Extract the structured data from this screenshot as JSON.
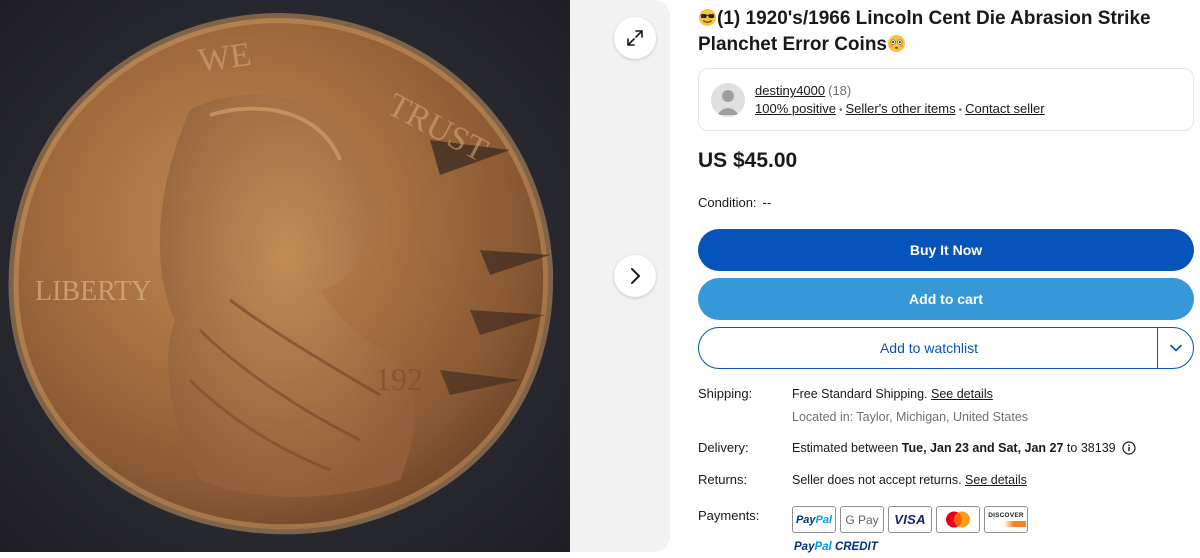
{
  "listing": {
    "title": "(1) 1920's/1966 Lincoln Cent Die Abrasion Strike Planchet Error Coins",
    "title_emoji_start": "smiling-face-with-sunglasses",
    "title_emoji_end": "flushed-face"
  },
  "photo": {
    "coin_text_liberty": "LIBERTY",
    "coin_text_we": "WE",
    "coin_text_trust": "TRUST",
    "coin_text_year": "192"
  },
  "gallery": {
    "expand_icon": "expand-arrows-icon",
    "next_icon": "chevron-right-icon"
  },
  "seller": {
    "name": "destiny4000",
    "feedback_count": "(18)",
    "positive": "100% positive",
    "other_items": "Seller's other items",
    "contact": "Contact seller"
  },
  "price": "US $45.00",
  "condition": {
    "label": "Condition:",
    "value": "--"
  },
  "actions": {
    "buy_now": "Buy It Now",
    "add_to_cart": "Add to cart",
    "add_to_watchlist": "Add to watchlist",
    "colors": {
      "buy_now": "#0654ba",
      "add_to_cart": "#3798d7"
    }
  },
  "shipping": {
    "label": "Shipping:",
    "value": "Free Standard Shipping.",
    "details_link": "See details",
    "location_label": "Located in:",
    "location": "Taylor, Michigan, United States"
  },
  "delivery": {
    "label": "Delivery:",
    "prefix": "Estimated between",
    "range": "Tue, Jan 23 and Sat, Jan 27",
    "to_text": "to",
    "zip": "38139"
  },
  "returns": {
    "label": "Returns:",
    "value": "Seller does not accept returns.",
    "details_link": "See details"
  },
  "payments": {
    "label": "Payments:",
    "methods": [
      "PayPal",
      "G Pay",
      "VISA",
      "Mastercard",
      "DISCOVER"
    ],
    "discover_text": "DISCOVER",
    "paypal_credit_1": "PayPal",
    "paypal_credit_2": "CREDIT"
  }
}
